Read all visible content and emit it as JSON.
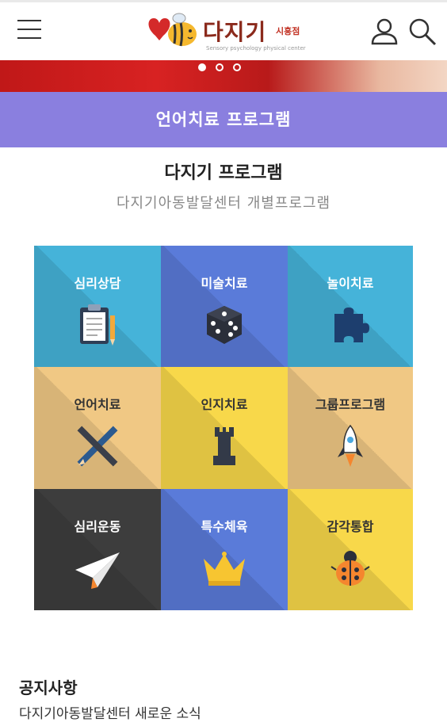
{
  "header": {
    "logo_text": "다지기",
    "logo_branch": "시흥점",
    "logo_sub": "Sensory psychology physical center"
  },
  "banner": {
    "slides": 3,
    "active_slide": 1
  },
  "program_bar": "언어치료 프로그램",
  "section": {
    "title": "다지기 프로그램",
    "subtitle": "다지기아동발달센터 개별프로그램"
  },
  "programs": [
    {
      "label": "심리상담",
      "icon": "clipboard-icon",
      "color": "#45b3d9",
      "text": "#ffffff"
    },
    {
      "label": "미술치료",
      "icon": "dice-icon",
      "color": "#5a7bd9",
      "text": "#ffffff"
    },
    {
      "label": "놀이치료",
      "icon": "puzzle-icon",
      "color": "#45b3d9",
      "text": "#ffffff"
    },
    {
      "label": "언어치료",
      "icon": "pencil-ruler-icon",
      "color": "#f0c884",
      "text": "#333333"
    },
    {
      "label": "인지치료",
      "icon": "chess-rook-icon",
      "color": "#f8d84a",
      "text": "#333333"
    },
    {
      "label": "그룹프로그램",
      "icon": "rocket-icon",
      "color": "#f0c884",
      "text": "#333333"
    },
    {
      "label": "심리운동",
      "icon": "paper-plane-icon",
      "color": "#3d3d3d",
      "text": "#ffffff"
    },
    {
      "label": "특수체육",
      "icon": "crown-icon",
      "color": "#5a7bd9",
      "text": "#ffffff"
    },
    {
      "label": "감각통합",
      "icon": "ladybug-icon",
      "color": "#f8d84a",
      "text": "#333333"
    }
  ],
  "notice": {
    "title": "공지사항",
    "items": [
      "다지기아동발달센터 새로운 소식"
    ]
  }
}
